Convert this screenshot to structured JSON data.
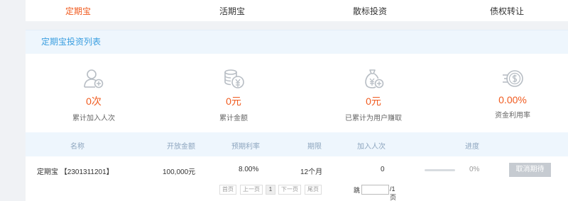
{
  "tabs": [
    {
      "label": "定期宝"
    },
    {
      "label": "活期宝"
    },
    {
      "label": "散标投资"
    },
    {
      "label": "债权转让"
    }
  ],
  "colors": {
    "accent": "#f05a1e",
    "link": "#3a9ee0",
    "header_bg": "#eef6fd"
  },
  "panel": {
    "title": "定期宝投资列表"
  },
  "stats": [
    {
      "icon": "user-add-icon",
      "value": "0次",
      "label": "累计加入人次"
    },
    {
      "icon": "coins-icon",
      "value": "0元",
      "label": "累计金额"
    },
    {
      "icon": "money-bag-icon",
      "value": "0元",
      "label": "已累计为用户赚取"
    },
    {
      "icon": "dollar-coin-icon",
      "value": "0.00%",
      "label": "资金利用率"
    }
  ],
  "table": {
    "headers": [
      "名称",
      "开放金额",
      "预期利率",
      "期限",
      "加入人次",
      "进度"
    ],
    "rows": [
      {
        "name": "定期宝 【2301311201】",
        "amount": "100,000元",
        "rate": "8.00%",
        "term": "12个月",
        "count": "0",
        "progress": 0,
        "progress_text": "0%",
        "action": "取消期待"
      }
    ]
  },
  "pager": {
    "first": "首页",
    "prev": "上一页",
    "current": "1",
    "next": "下一页",
    "last": "尾页",
    "jump_label": "跳",
    "jump_value": "",
    "total": "/1页"
  }
}
